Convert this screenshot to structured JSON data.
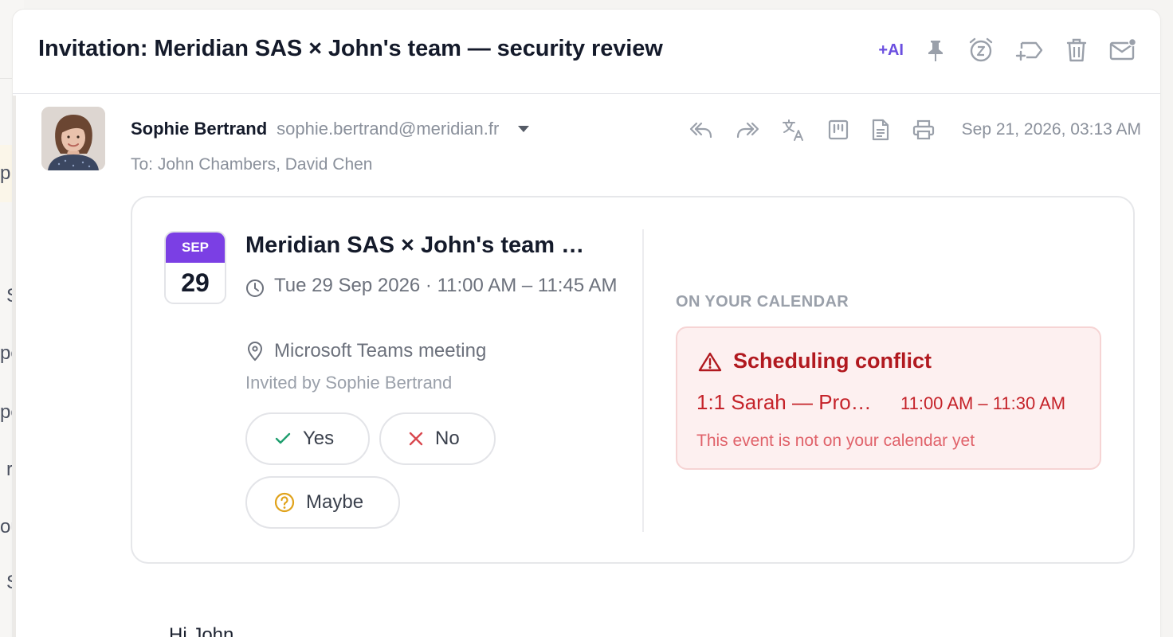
{
  "email": {
    "subject": "Invitation: Meridian SAS × John's team — security review",
    "toolbar": {
      "ai_label": "+AI"
    },
    "sender": {
      "name": "Sophie Bertrand",
      "email": "sophie.bertrand@meridian.fr"
    },
    "to_line": "To: John Chambers, David Chen",
    "date": "Sep 21, 2026, 03:13 AM",
    "body_preview": "Hi John"
  },
  "invite": {
    "month": "SEP",
    "day": "29",
    "title": "Meridian SAS × John's team …",
    "time": "Tue 29 Sep 2026 · 11:00 AM – 11:45 AM",
    "location": "Microsoft Teams meeting",
    "invited_by": "Invited by Sophie Bertrand",
    "rsvp": {
      "yes": "Yes",
      "no": "No",
      "maybe": "Maybe"
    },
    "calendar_label": "ON YOUR CALENDAR",
    "conflict": {
      "title": "Scheduling conflict",
      "event": "1:1 Sarah — Pro…",
      "time": "11:00 AM – 11:30 AM",
      "note": "This event is not on your calendar yet"
    }
  },
  "background_list": {
    "glyphs": [
      "p",
      "S",
      "pe",
      "pe",
      "r",
      "ou",
      "S"
    ]
  },
  "colors": {
    "accent_purple": "#7b3fe4",
    "ai_purple": "#6b4fe0",
    "conflict_red": "#b1191f",
    "yes_green": "#1f9e6e",
    "no_red": "#d9484f",
    "maybe_amber": "#e0a21a"
  }
}
